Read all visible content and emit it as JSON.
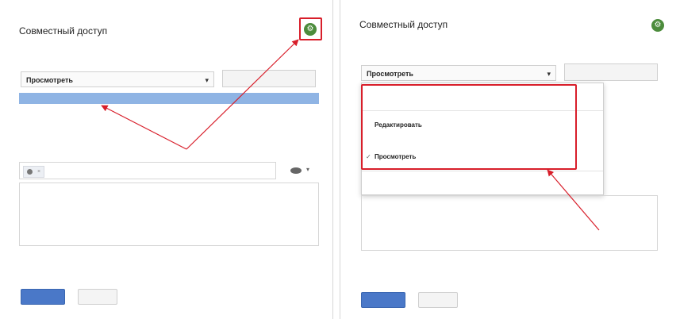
{
  "colors": {
    "accent_red": "#d81e2a",
    "button_blue": "#4a78c8",
    "link_blue": "#3a6ed0",
    "gear_green": "#4c8c3c"
  },
  "icons": [
    "gear-icon",
    "person-icon",
    "eye-icon",
    "caret-down-icon",
    "checkmark-icon",
    "close-icon"
  ],
  "left": {
    "title": "Совместный доступ",
    "settings_link": "",
    "access_label": "",
    "access_change": "",
    "permission_bold": "Просмотреть",
    "permission_rest": "",
    "permission_caret": "▾",
    "copy_link": "",
    "link_text": "",
    "people_label": "",
    "chip_email": "",
    "chip_close": "×",
    "add_people_placeholder": "",
    "eye_caret": "▾",
    "note_placeholder": "",
    "footer_left": "",
    "footer_right": "",
    "send_button": "",
    "cancel_button": "",
    "advanced": ""
  },
  "right": {
    "title": "Совместный доступ",
    "settings_link": "",
    "access_label": "",
    "access_change": "",
    "permission_bold": "Просмотреть",
    "permission_rest": "",
    "permission_caret": "▾",
    "copy_link": "",
    "menu": {
      "off_bold": "",
      "off_rest": "",
      "edit_bold": "Редактировать",
      "edit_rest": "",
      "comment_bold": "",
      "comment_rest": "",
      "view_bold": "Просмотреть",
      "view_rest": "",
      "view_check": "✓",
      "more": ""
    },
    "footer_left": "",
    "footer_right": "",
    "send_button": "",
    "cancel_button": "",
    "advanced": ""
  }
}
